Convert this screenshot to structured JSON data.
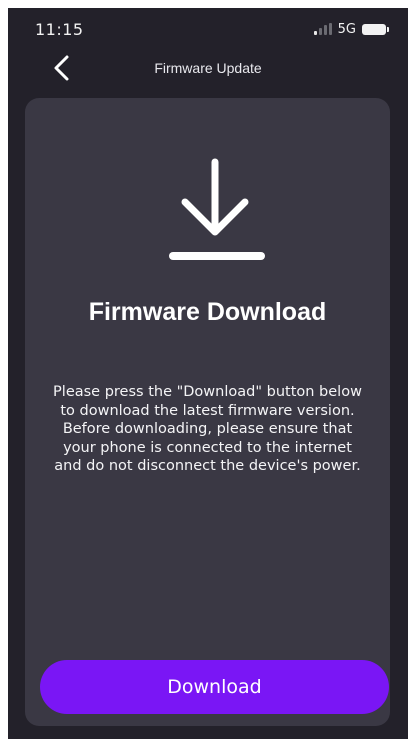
{
  "status_bar": {
    "time": "11:15",
    "network": "5G"
  },
  "header": {
    "title": "Firmware Update"
  },
  "card": {
    "title": "Firmware Download",
    "description": "Please press the \"Download\" button below to download the latest firmware version. Before downloading, please ensure that your phone is connected to the internet and do not disconnect the device's power.",
    "button_label": "Download"
  },
  "icons": {
    "back": "chevron-left-icon",
    "download": "download-arrow-icon",
    "signal": "signal-icon",
    "battery": "battery-icon"
  },
  "colors": {
    "background": "#23212a",
    "card": "#3a3844",
    "accent": "#7a16f5",
    "text": "#ffffff"
  }
}
